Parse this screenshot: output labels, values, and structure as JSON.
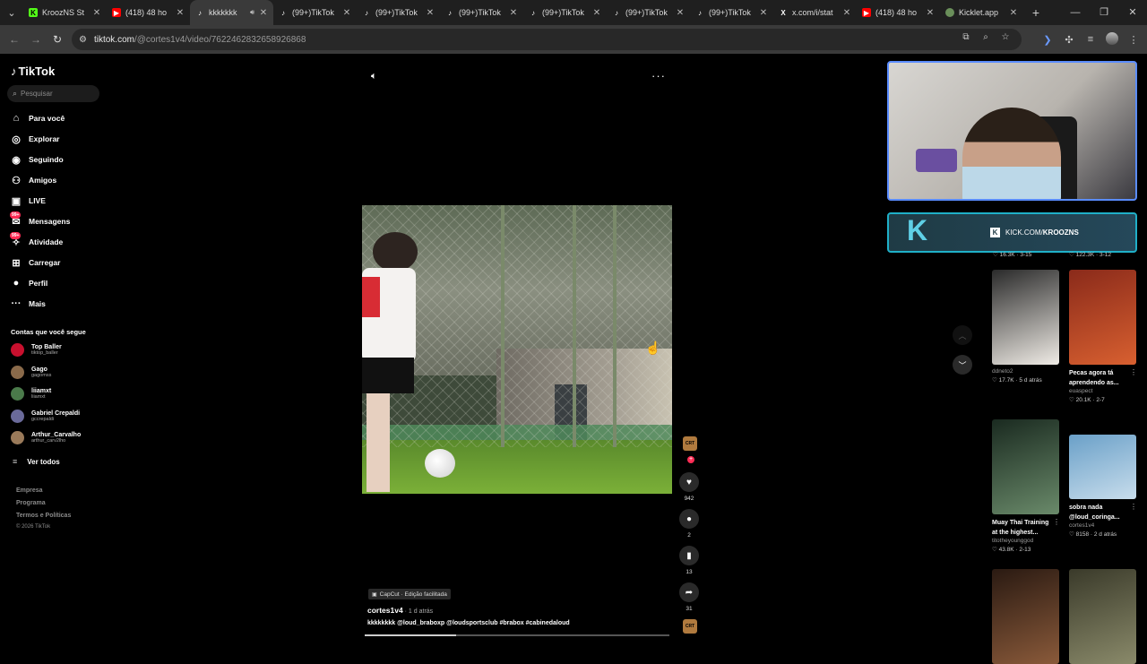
{
  "browser": {
    "tabs": [
      {
        "icon": "kick",
        "title": "KroozNS St"
      },
      {
        "icon": "youtube",
        "title": "(418) 48 ho"
      },
      {
        "icon": "tiktok",
        "title": "kkkkkkk",
        "active": true,
        "audio": true
      },
      {
        "icon": "tiktok",
        "title": "(99+)TikTok"
      },
      {
        "icon": "tiktok",
        "title": "(99+)TikTok"
      },
      {
        "icon": "tiktok",
        "title": "(99+)TikTok"
      },
      {
        "icon": "tiktok",
        "title": "(99+)TikTok"
      },
      {
        "icon": "tiktok",
        "title": "(99+)TikTok"
      },
      {
        "icon": "tiktok",
        "title": "(99+)TikTok"
      },
      {
        "icon": "x",
        "title": "x.com/i/stat"
      },
      {
        "icon": "youtube",
        "title": "(418) 48 ho"
      },
      {
        "icon": "kicklet",
        "title": "Kicklet.app"
      }
    ],
    "url_domain": "tiktok.com",
    "url_path": "/@cortes1v4/video/7622462832658926868"
  },
  "sidebar": {
    "logo": "TikTok",
    "search_placeholder": "Pesquisar",
    "menu": [
      {
        "label": "Para você",
        "icon": "home-icon"
      },
      {
        "label": "Explorar",
        "icon": "compass-icon"
      },
      {
        "label": "Seguindo",
        "icon": "following-icon"
      },
      {
        "label": "Amigos",
        "icon": "friends-icon"
      },
      {
        "label": "LIVE",
        "icon": "live-icon"
      },
      {
        "label": "Mensagens",
        "icon": "messages-icon",
        "badge": "99+"
      },
      {
        "label": "Atividade",
        "icon": "activity-icon",
        "badge": "99+"
      },
      {
        "label": "Carregar",
        "icon": "upload-icon"
      },
      {
        "label": "Perfil",
        "icon": "profile-icon"
      },
      {
        "label": "Mais",
        "icon": "more-icon"
      }
    ],
    "following_title": "Contas que você segue",
    "following": [
      {
        "name": "Top Baller",
        "handle": "tiktop_baller",
        "color": "#c8102e"
      },
      {
        "name": "Gago",
        "handle": "gagomss",
        "color": "#8a6a4a"
      },
      {
        "name": "liiamxt",
        "handle": "liiamxt",
        "color": "#4a7a4a"
      },
      {
        "name": "Gabriel Crepaldi",
        "handle": "gccrepaldi",
        "color": "#6a6a9a"
      },
      {
        "name": "Arthur_Carvalho",
        "handle": "arthur_carv2lho",
        "color": "#9a7a5a"
      }
    ],
    "see_all": "Ver todos",
    "footer": [
      "Empresa",
      "Programa",
      "Termos e Políticas"
    ],
    "copyright": "© 2026 TikTok"
  },
  "video": {
    "likes": "942",
    "comments": "2",
    "saves": "13",
    "shares": "31",
    "capcut": "CapCut · Edição facilitada",
    "author": "cortes1v4",
    "time": " · 1 d atrás",
    "description": "kkkkkkkk @loud_braboxp @loudsportsclub #brabox #cabinedaloud",
    "progress": 0.3
  },
  "stream_overlay": {
    "kick_label_prefix": "KICK.COM/",
    "kick_label_name": "KROOZNS"
  },
  "recommendations": {
    "top_row": [
      "♡ 16.3K · 3-15",
      "♡ 122.3K · 3-12"
    ],
    "cards": [
      {
        "title": "",
        "author": "ddneto2",
        "stats": "♡ 17.7K · 5 d atrás",
        "colors": [
          "#2a2a2a",
          "#f0ece6"
        ]
      },
      {
        "title": "Pecas agora tá aprendendo as...",
        "author": "euaspect",
        "stats": "♡ 20.1K · 2-7",
        "colors": [
          "#8a2a1a",
          "#d86030"
        ]
      },
      {
        "title": "Muay Thai Training at the highest...",
        "author": "titotheyounggod",
        "stats": "♡ 43.8K · 2-13",
        "colors": [
          "#1a2a20",
          "#6a8a6a"
        ]
      },
      {
        "title": "sobra nada @loud_coringa...",
        "author": "cortes1v4",
        "stats": "♡ 8158 · 2 d atrás",
        "colors": [
          "#6aa0c8",
          "#c8ddec"
        ]
      },
      {
        "title": "",
        "author": "",
        "stats": "",
        "colors": [
          "#2a1a12",
          "#8a5a3a"
        ]
      },
      {
        "title": "",
        "author": "",
        "stats": "",
        "colors": [
          "#3a3a2a",
          "#8a8a6a"
        ]
      }
    ]
  }
}
